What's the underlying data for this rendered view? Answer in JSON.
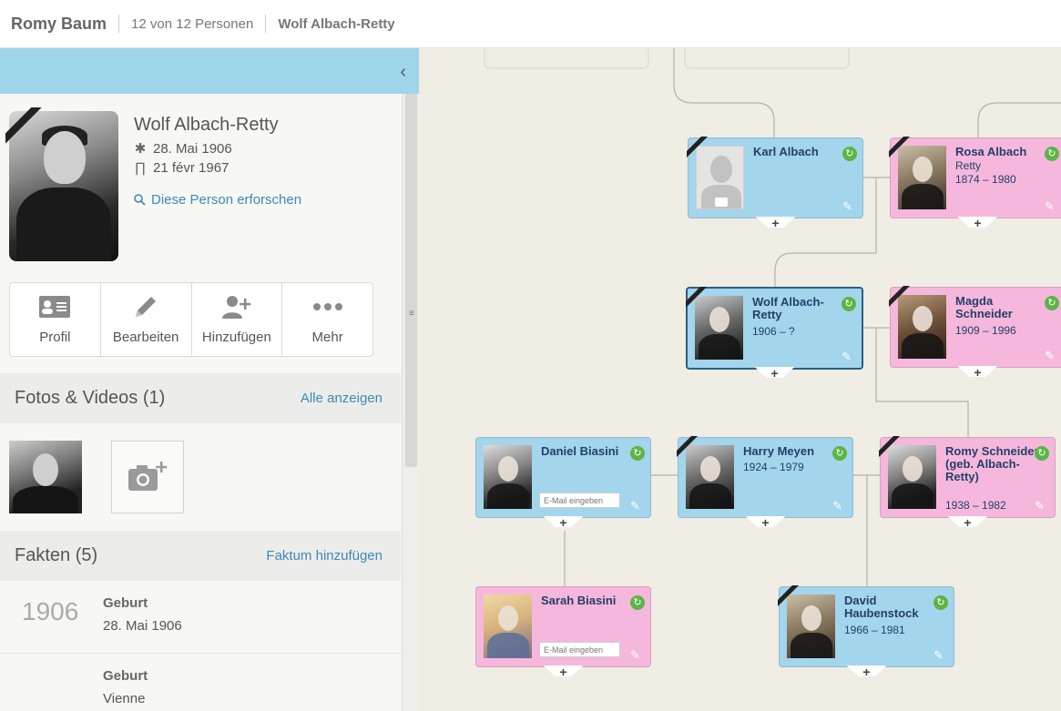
{
  "header": {
    "tree_name": "Romy Baum",
    "count": "12 von 12 Personen",
    "current_person": "Wolf Albach-Retty"
  },
  "panel": {
    "collapse_icon": "chevron-left-icon",
    "person": {
      "name": "Wolf Albach-Retty",
      "birth": "28. Mai 1906",
      "death": "21 févr 1967",
      "research_link": "Diese Person erforschen"
    },
    "actions": [
      {
        "label": "Profil",
        "icon": "profile-card-icon"
      },
      {
        "label": "Bearbeiten",
        "icon": "pencil-icon"
      },
      {
        "label": "Hinzufügen",
        "icon": "add-person-icon"
      },
      {
        "label": "Mehr",
        "icon": "more-dots-icon"
      }
    ],
    "photos": {
      "title": "Fotos & Videos (1)",
      "link": "Alle anzeigen"
    },
    "facts": {
      "title": "Fakten (5)",
      "link": "Faktum hinzufügen",
      "items": [
        {
          "year": "1906",
          "type": "Geburt",
          "value": "28. Mai 1906"
        },
        {
          "year": "",
          "type": "Geburt",
          "value": "Vienne"
        }
      ]
    }
  },
  "tree": {
    "email_placeholder": "E-Mail eingeben",
    "people": {
      "karl": {
        "name": "Karl Albach",
        "sub": "",
        "dates": ""
      },
      "rosa": {
        "name": "Rosa Albach",
        "sub": "Retty",
        "dates": "1874 – 1980"
      },
      "wolf": {
        "name": "Wolf Albach-Retty",
        "dates": "1906 – ?"
      },
      "magda": {
        "name": "Magda Schneider",
        "dates": "1909 – 1996"
      },
      "daniel": {
        "name": "Daniel Biasini"
      },
      "harry": {
        "name": "Harry Meyen",
        "dates": "1924 – 1979"
      },
      "romy": {
        "name": "Romy Schneider (geb. Albach-Retty)",
        "dates": "1938 – 1982"
      },
      "sarah": {
        "name": "Sarah Biasini"
      },
      "david": {
        "name": "David Haubenstock",
        "dates": "1966 – 1981"
      }
    }
  },
  "colors": {
    "male_card": "#a3d5ec",
    "female_card": "#f5b8dc",
    "name_text": "#233f6a",
    "canvas": "#f0ede4",
    "link": "#3d8ab8",
    "sync_badge": "#5bb544"
  }
}
